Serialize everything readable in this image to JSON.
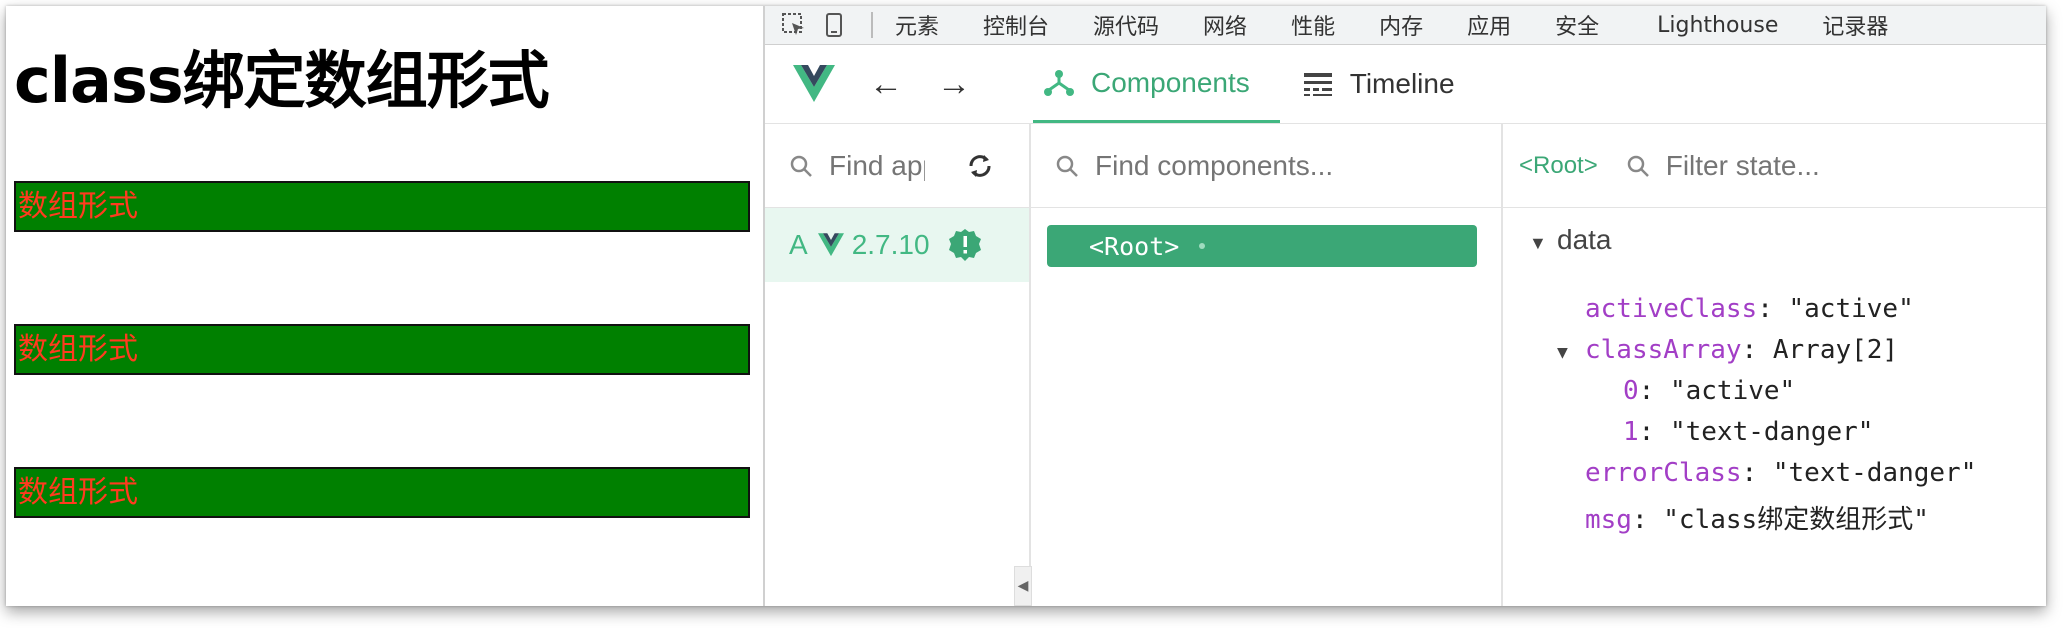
{
  "page": {
    "title": "class绑定数组形式",
    "boxes": [
      "数组形式",
      "数组形式",
      "数组形式"
    ]
  },
  "chrome_tabs": [
    "元素",
    "控制台",
    "源代码",
    "网络",
    "性能",
    "内存",
    "应用",
    "安全",
    "Lighthouse",
    "记录器"
  ],
  "vue_tabs": {
    "components": "Components",
    "timeline": "Timeline"
  },
  "apps_panel": {
    "search_placeholder": "Find apps...",
    "app_label": "A",
    "version": "2.7.10"
  },
  "tree_panel": {
    "search_placeholder": "Find components...",
    "root_node": "<Root>"
  },
  "state_panel": {
    "crumb": "<Root>",
    "search_placeholder": "Filter state...",
    "section": "data",
    "rows": {
      "active_key": "activeClass",
      "active_val": "\"active\"",
      "array_key": "classArray",
      "array_val": "Array[2]",
      "item0_key": "0",
      "item0_val": "\"active\"",
      "item1_key": "1",
      "item1_val": "\"text-danger\"",
      "error_key": "errorClass",
      "error_val": "\"text-danger\"",
      "msg_key": "msg",
      "msg_val": "\"class绑定数组形式\""
    }
  },
  "colors": {
    "vue_green": "#42b883",
    "box_bg": "#008000",
    "box_text": "#ff3b1f",
    "key_purple": "#a23ec6"
  }
}
